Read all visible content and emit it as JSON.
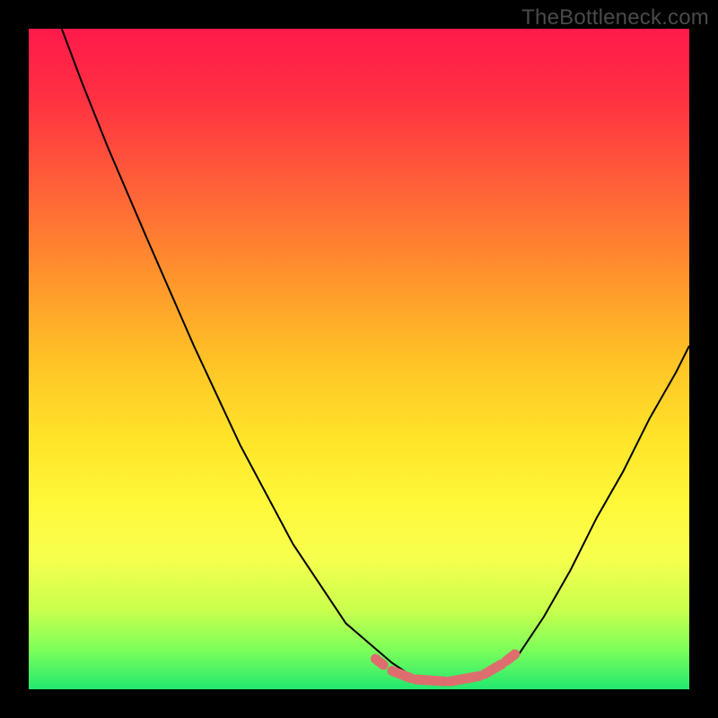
{
  "watermark": "TheBottleneck.com",
  "colors": {
    "background": "#000000",
    "curve": "#000000",
    "marker": "#de6e6e",
    "gradient_stops": [
      "#ff1a4b",
      "#ff2f42",
      "#ff5a3a",
      "#ff8a2e",
      "#ffc226",
      "#ffe429",
      "#fff83a",
      "#f7ff4e",
      "#caff4d",
      "#7dff5a",
      "#22e86e"
    ]
  },
  "chart_data": {
    "type": "line",
    "title": "",
    "xlabel": "",
    "ylabel": "",
    "xlim": [
      0,
      100
    ],
    "ylim": [
      0,
      100
    ],
    "grid": false,
    "legend": false,
    "series": [
      {
        "name": "curve",
        "x": [
          5,
          8,
          12,
          18,
          25,
          32,
          40,
          48,
          55,
          58,
          60,
          62,
          65,
          68,
          70,
          74,
          78,
          82,
          86,
          90,
          94,
          98,
          100
        ],
        "y": [
          100,
          92,
          82,
          68,
          52,
          37,
          22,
          10,
          4,
          2,
          1,
          1,
          1,
          2,
          3,
          5,
          11,
          18,
          26,
          33,
          41,
          48,
          52
        ]
      }
    ],
    "markers": {
      "name": "bottom-highlight-dashes",
      "stroke_width_px": 11,
      "segments": [
        {
          "x1": 52.5,
          "y1": 4.6,
          "x2": 53.7,
          "y2": 3.7
        },
        {
          "x1": 55.0,
          "y1": 2.8,
          "x2": 57.8,
          "y2": 1.7
        },
        {
          "x1": 58.6,
          "y1": 1.5,
          "x2": 63.0,
          "y2": 1.2
        },
        {
          "x1": 63.8,
          "y1": 1.2,
          "x2": 68.2,
          "y2": 2.0
        },
        {
          "x1": 69.0,
          "y1": 2.3,
          "x2": 71.6,
          "y2": 3.8
        },
        {
          "x1": 72.3,
          "y1": 4.3,
          "x2": 73.6,
          "y2": 5.3
        }
      ]
    }
  }
}
